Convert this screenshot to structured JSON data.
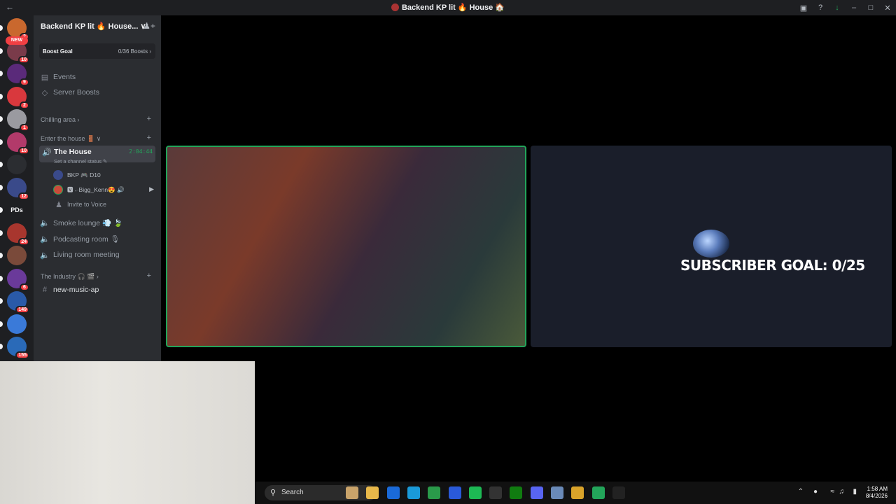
{
  "window": {
    "title": "Backend KP lit 🔥 House 🏠",
    "back_glyph": "←",
    "controls": {
      "inbox": "▣",
      "help": "?",
      "download": "↓",
      "minimize": "–",
      "maximize": "□",
      "close": "✕"
    }
  },
  "rail": {
    "new_tag": "NEW",
    "servers": [
      {
        "badge": "2",
        "color": "#c9682e"
      },
      {
        "badge": "10",
        "color": "#7a3b4a"
      },
      {
        "badge": "9",
        "color": "#5a2a7a"
      },
      {
        "badge": "2",
        "color": "#d9383d"
      },
      {
        "badge": "1",
        "color": "#9a9aa0"
      },
      {
        "badge": "10",
        "color": "#b23a6a"
      },
      {
        "badge": "",
        "color": "#2b2d31"
      },
      {
        "badge": "12",
        "color": "#3a4a8a"
      },
      {
        "badge": "",
        "color": "#1e1f22",
        "text": "PDs"
      },
      {
        "badge": "24",
        "color": "#a8362e"
      },
      {
        "badge": "",
        "color": "#7a4a3a"
      },
      {
        "badge": "6",
        "color": "#6a3a9a"
      },
      {
        "badge": "149",
        "color": "#2a5aa8"
      },
      {
        "badge": "",
        "color": "#3a7ad9"
      },
      {
        "badge": "155",
        "color": "#2a6ab8"
      }
    ]
  },
  "sidebar": {
    "guild_name": "Backend KP lit 🔥 House...",
    "chevron": "∨",
    "boost_goal_label": "Boost Goal",
    "boost_goal_value": "0/36 Boosts ›",
    "events_label": "Events",
    "server_boosts_label": "Server Boosts",
    "category_chilling": "Chilling area ›",
    "category_enter": "Enter the house 🚪 ∨",
    "active_channel": "The House",
    "active_timer": "2:04:44",
    "channel_status": "Set a channel status ✎",
    "voice_users": [
      {
        "name": "BKP 🎮 D10",
        "color": "#3a4a8a"
      },
      {
        "name": "🆅 ˖·Bigg_Kenn😍 🔊",
        "color": "#c94a3a"
      }
    ],
    "invite_label": "Invite to Voice",
    "channels": [
      {
        "label": "Smoke lounge 💨 🍃"
      },
      {
        "label": "Podcasting room 🎙"
      },
      {
        "label": "Living room meeting"
      }
    ],
    "category_industry": "The Industry 🎧 🎬 ›",
    "text_channel": "new-music-ap"
  },
  "call": {
    "overlay_text": "SUBSCRIBER GOAL: 0/25"
  },
  "taskbar": {
    "search_placeholder": "Search",
    "time": "1:58 AM",
    "date": "8/4/2026",
    "apps": [
      {
        "name": "widgets",
        "color": "#c9a36a"
      },
      {
        "name": "file-explorer",
        "color": "#e8b84a"
      },
      {
        "name": "outlook",
        "color": "#1a6ad9"
      },
      {
        "name": "edge",
        "color": "#1a9ad9"
      },
      {
        "name": "vim",
        "color": "#2a9a4a"
      },
      {
        "name": "tool",
        "color": "#2a5ad9"
      },
      {
        "name": "spotify",
        "color": "#1db954"
      },
      {
        "name": "capcut",
        "color": "#333333"
      },
      {
        "name": "xbox",
        "color": "#107c10"
      },
      {
        "name": "discord",
        "color": "#5865f2"
      },
      {
        "name": "notepad",
        "color": "#6a8ab8"
      },
      {
        "name": "chrome",
        "color": "#d9a32a"
      },
      {
        "name": "green-app",
        "color": "#23a55a"
      },
      {
        "name": "terminal",
        "color": "#222222"
      }
    ]
  }
}
